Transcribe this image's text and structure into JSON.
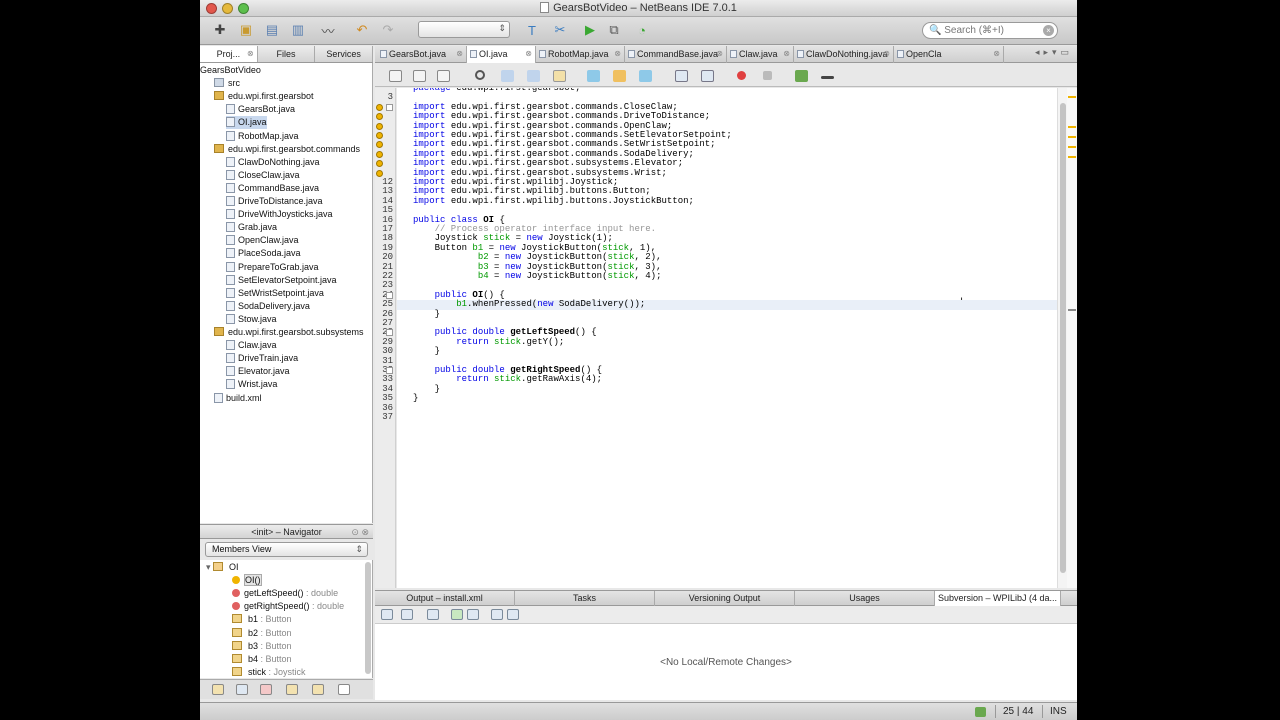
{
  "window": {
    "title": "GearsBotVideo – NetBeans IDE 7.0.1"
  },
  "search": {
    "placeholder": "Search (⌘+I)"
  },
  "left_tabs": [
    "Proj...",
    "Files",
    "Services"
  ],
  "project_tree": [
    {
      "label": "GearsBotVideo",
      "indent": 0,
      "kind": "project"
    },
    {
      "label": "src",
      "indent": 1,
      "kind": "folder"
    },
    {
      "label": "edu.wpi.first.gearsbot",
      "indent": 2,
      "kind": "package"
    },
    {
      "label": "GearsBot.java",
      "indent": 3,
      "kind": "file"
    },
    {
      "label": "OI.java",
      "indent": 3,
      "kind": "file",
      "selected": true
    },
    {
      "label": "RobotMap.java",
      "indent": 3,
      "kind": "file"
    },
    {
      "label": "edu.wpi.first.gearsbot.commands",
      "indent": 2,
      "kind": "package"
    },
    {
      "label": "ClawDoNothing.java",
      "indent": 3,
      "kind": "file"
    },
    {
      "label": "CloseClaw.java",
      "indent": 3,
      "kind": "file"
    },
    {
      "label": "CommandBase.java",
      "indent": 3,
      "kind": "file"
    },
    {
      "label": "DriveToDistance.java",
      "indent": 3,
      "kind": "file"
    },
    {
      "label": "DriveWithJoysticks.java",
      "indent": 3,
      "kind": "file"
    },
    {
      "label": "Grab.java",
      "indent": 3,
      "kind": "file"
    },
    {
      "label": "OpenClaw.java",
      "indent": 3,
      "kind": "file"
    },
    {
      "label": "PlaceSoda.java",
      "indent": 3,
      "kind": "file"
    },
    {
      "label": "PrepareToGrab.java",
      "indent": 3,
      "kind": "file"
    },
    {
      "label": "SetElevatorSetpoint.java",
      "indent": 3,
      "kind": "file"
    },
    {
      "label": "SetWristSetpoint.java",
      "indent": 3,
      "kind": "file"
    },
    {
      "label": "SodaDelivery.java",
      "indent": 3,
      "kind": "file"
    },
    {
      "label": "Stow.java",
      "indent": 3,
      "kind": "file"
    },
    {
      "label": "edu.wpi.first.gearsbot.subsystems",
      "indent": 2,
      "kind": "package"
    },
    {
      "label": "Claw.java",
      "indent": 3,
      "kind": "file"
    },
    {
      "label": "DriveTrain.java",
      "indent": 3,
      "kind": "file"
    },
    {
      "label": "Elevator.java",
      "indent": 3,
      "kind": "file"
    },
    {
      "label": "Wrist.java",
      "indent": 3,
      "kind": "file"
    },
    {
      "label": "build.xml",
      "indent": 1,
      "kind": "file"
    }
  ],
  "navigator": {
    "title": "<init> – Navigator",
    "view": "Members View",
    "items": [
      {
        "name": "OI",
        "type": "",
        "kind": "class"
      },
      {
        "name": "OI()",
        "type": "",
        "kind": "ctor"
      },
      {
        "name": "getLeftSpeed()",
        "type": " : double",
        "kind": "method"
      },
      {
        "name": "getRightSpeed()",
        "type": " : double",
        "kind": "method"
      },
      {
        "name": "b1",
        "type": " : Button",
        "kind": "field"
      },
      {
        "name": "b2",
        "type": " : Button",
        "kind": "field"
      },
      {
        "name": "b3",
        "type": " : Button",
        "kind": "field"
      },
      {
        "name": "b4",
        "type": " : Button",
        "kind": "field"
      },
      {
        "name": "stick",
        "type": " : Joystick",
        "kind": "field"
      }
    ]
  },
  "editor_tabs": [
    {
      "label": "GearsBot.java",
      "active": false
    },
    {
      "label": "OI.java",
      "active": true
    },
    {
      "label": "RobotMap.java",
      "active": false
    },
    {
      "label": "CommandBase.java",
      "active": false
    },
    {
      "label": "Claw.java",
      "active": false
    },
    {
      "label": "ClawDoNothing.java",
      "active": false
    },
    {
      "label": "OpenCla",
      "active": false
    }
  ],
  "code_lines": [
    {
      "n": "",
      "text": "package edu.wpi.first.gearsbot;"
    },
    {
      "n": "3",
      "text": ""
    },
    {
      "n": "",
      "text": "import edu.wpi.first.gearsbot.commands.CloseClaw;"
    },
    {
      "n": "",
      "text": "import edu.wpi.first.gearsbot.commands.DriveToDistance;"
    },
    {
      "n": "",
      "text": "import edu.wpi.first.gearsbot.commands.OpenClaw;"
    },
    {
      "n": "",
      "text": "import edu.wpi.first.gearsbot.commands.SetElevatorSetpoint;"
    },
    {
      "n": "",
      "text": "import edu.wpi.first.gearsbot.commands.SetWristSetpoint;"
    },
    {
      "n": "",
      "text": "import edu.wpi.first.gearsbot.commands.SodaDelivery;"
    },
    {
      "n": "",
      "text": "import edu.wpi.first.gearsbot.subsystems.Elevator;"
    },
    {
      "n": "",
      "text": "import edu.wpi.first.gearsbot.subsystems.Wrist;"
    },
    {
      "n": "12",
      "text": "import edu.wpi.first.wpilibj.Joystick;"
    },
    {
      "n": "13",
      "text": "import edu.wpi.first.wpilibj.buttons.Button;"
    },
    {
      "n": "14",
      "text": "import edu.wpi.first.wpilibj.buttons.JoystickButton;"
    },
    {
      "n": "15",
      "text": ""
    },
    {
      "n": "16",
      "text": "public class OI {"
    },
    {
      "n": "17",
      "text": "    // Process operator interface input here."
    },
    {
      "n": "18",
      "text": "    Joystick stick = new Joystick(1);"
    },
    {
      "n": "19",
      "text": "    Button b1 = new JoystickButton(stick, 1),"
    },
    {
      "n": "20",
      "text": "            b2 = new JoystickButton(stick, 2),"
    },
    {
      "n": "21",
      "text": "            b3 = new JoystickButton(stick, 3),"
    },
    {
      "n": "22",
      "text": "            b4 = new JoystickButton(stick, 4);"
    },
    {
      "n": "23",
      "text": ""
    },
    {
      "n": "24",
      "text": "    public OI() {"
    },
    {
      "n": "25",
      "text": "        b1.whenPressed(new SodaDelivery());"
    },
    {
      "n": "26",
      "text": "    }"
    },
    {
      "n": "27",
      "text": ""
    },
    {
      "n": "28",
      "text": "    public double getLeftSpeed() {"
    },
    {
      "n": "29",
      "text": "        return stick.getY();"
    },
    {
      "n": "30",
      "text": "    }"
    },
    {
      "n": "31",
      "text": ""
    },
    {
      "n": "32",
      "text": "    public double getRightSpeed() {"
    },
    {
      "n": "33",
      "text": "        return stick.getRawAxis(4);"
    },
    {
      "n": "34",
      "text": "    }"
    },
    {
      "n": "35",
      "text": "}"
    },
    {
      "n": "36",
      "text": ""
    },
    {
      "n": "37",
      "text": ""
    }
  ],
  "output_tabs": [
    {
      "label": "Output – install.xml",
      "active": false
    },
    {
      "label": "Tasks",
      "active": false
    },
    {
      "label": "Versioning Output",
      "active": false
    },
    {
      "label": "Usages",
      "active": false
    },
    {
      "label": "Subversion – WPILibJ (4 da...",
      "active": true
    }
  ],
  "output": {
    "message": "<No Local/Remote Changes>"
  },
  "status": {
    "position": "25 | 44",
    "mode": "INS"
  },
  "colors": {
    "keyword": "#0000e6",
    "comment": "#969696",
    "field": "#009900",
    "selection": "#c8d8ee"
  }
}
